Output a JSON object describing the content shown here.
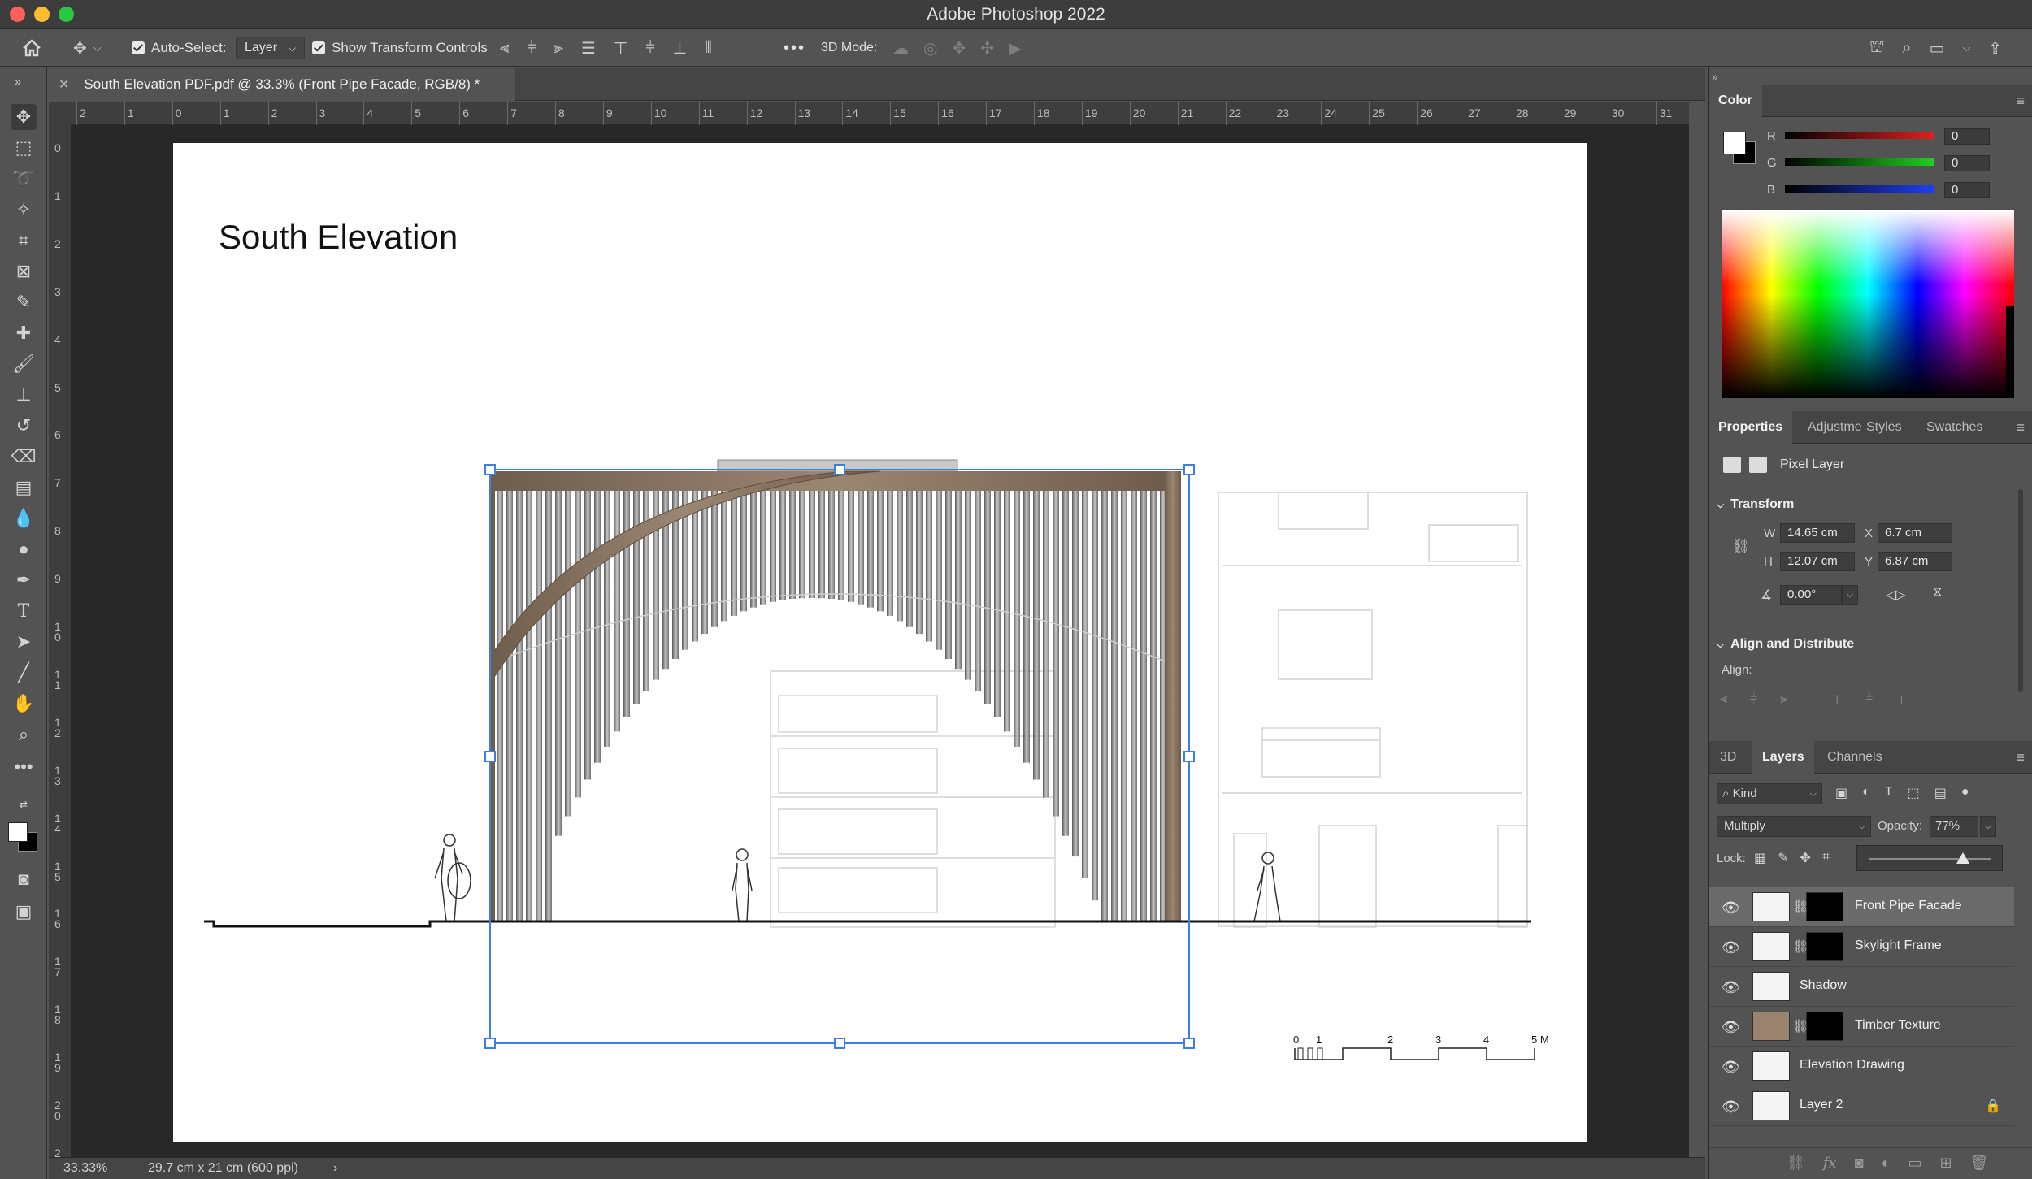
{
  "window": {
    "title": "Adobe Photoshop 2022"
  },
  "options_bar": {
    "auto_select_label": "Auto-Select:",
    "auto_select_value": "Layer",
    "show_transform_label": "Show Transform Controls",
    "mode_3d_label": "3D Mode:",
    "more": "•••"
  },
  "document": {
    "tab_title": "South Elevation PDF.pdf @ 33.3% (Front Pipe Facade, RGB/8) *",
    "heading": "South Elevation",
    "ruler_h": [
      "2",
      "1",
      "0",
      "1",
      "2",
      "3",
      "4",
      "5",
      "6",
      "7",
      "8",
      "9",
      "10",
      "11",
      "12",
      "13",
      "14",
      "15",
      "16",
      "17",
      "18",
      "19",
      "20",
      "21",
      "22",
      "23",
      "24",
      "25",
      "26",
      "27",
      "28",
      "29",
      "30",
      "31"
    ],
    "ruler_v": [
      "0",
      "1",
      "2",
      "3",
      "4",
      "5",
      "6",
      "7",
      "8",
      "9",
      "10",
      "11",
      "12",
      "13",
      "14",
      "15",
      "16",
      "17",
      "18",
      "19",
      "20",
      "2"
    ],
    "scale_labels": [
      "0",
      "1",
      "2",
      "3",
      "4",
      "5 M"
    ]
  },
  "status_bar": {
    "zoom": "33.33%",
    "doc_size": "29.7 cm x 21 cm (600 ppi)",
    "arrow": "›"
  },
  "color_panel": {
    "title": "Color",
    "r_label": "R",
    "g_label": "G",
    "b_label": "B",
    "r": "0",
    "g": "0",
    "b": "0",
    "fg_color": "#ffffff",
    "bg_color": "#000000"
  },
  "properties_panel": {
    "tabs": [
      "Properties",
      "Adjustme",
      "Styles",
      "Swatches"
    ],
    "layer_kind": "Pixel Layer",
    "transform_title": "Transform",
    "w_label": "W",
    "w": "14.65 cm",
    "h_label": "H",
    "h": "12.07 cm",
    "x_label": "X",
    "x": "6.7 cm",
    "y_label": "Y",
    "y": "6.87 cm",
    "angle": "0.00°",
    "align_title": "Align and Distribute",
    "align_label": "Align:"
  },
  "layers_panel": {
    "tabs": [
      "3D",
      "Layers",
      "Channels"
    ],
    "filter_kind": "Kind",
    "blend_mode": "Multiply",
    "opacity_label": "Opacity:",
    "opacity": "77%",
    "opacity_fraction": 0.77,
    "lock_label": "Lock:",
    "layers": [
      {
        "name": "Front Pipe Facade",
        "selected": true,
        "has_mask": true
      },
      {
        "name": "Skylight Frame",
        "selected": false,
        "has_mask": true
      },
      {
        "name": "Shadow",
        "selected": false,
        "has_mask": false
      },
      {
        "name": "Timber Texture",
        "selected": false,
        "has_mask": true
      },
      {
        "name": "Elevation Drawing",
        "selected": false,
        "has_mask": false
      },
      {
        "name": "Layer 2",
        "selected": false,
        "has_mask": false,
        "locked": true
      }
    ]
  }
}
